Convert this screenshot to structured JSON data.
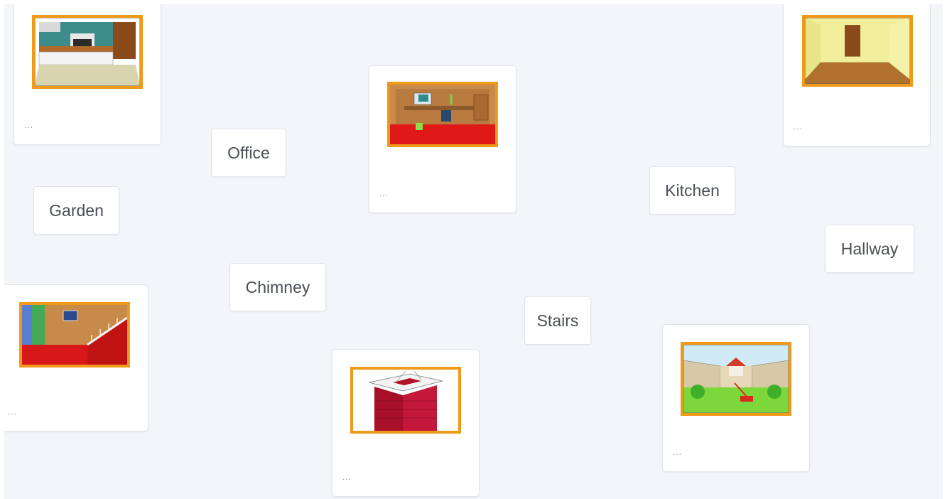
{
  "colors": {
    "board_bg": "#f3f5f8",
    "frame_orange": "#f09a1a",
    "label_text": "#4a4f55"
  },
  "image_cards": [
    {
      "id": "kitchen",
      "scene_icon": "kitchen-scene-icon",
      "menu": "..."
    },
    {
      "id": "office",
      "scene_icon": "office-scene-icon",
      "menu": "..."
    },
    {
      "id": "hallway",
      "scene_icon": "hallway-scene-icon",
      "menu": "..."
    },
    {
      "id": "stairs",
      "scene_icon": "stairs-scene-icon",
      "menu": "..."
    },
    {
      "id": "chimney",
      "scene_icon": "chimney-scene-icon",
      "menu": "..."
    },
    {
      "id": "garden",
      "scene_icon": "garden-scene-icon",
      "menu": "..."
    }
  ],
  "word_labels": {
    "office": "Office",
    "garden": "Garden",
    "kitchen": "Kitchen",
    "hallway": "Hallway",
    "chimney": "Chimney",
    "stairs": "Stairs"
  }
}
